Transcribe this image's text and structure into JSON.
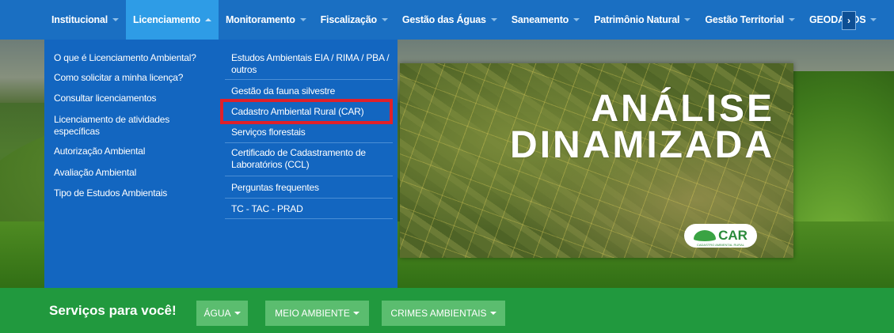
{
  "nav": {
    "items": [
      {
        "label": "Institucional"
      },
      {
        "label": "Licenciamento"
      },
      {
        "label": "Monitoramento"
      },
      {
        "label": "Fiscalização"
      },
      {
        "label": "Gestão das Águas"
      },
      {
        "label": "Saneamento"
      },
      {
        "label": "Patrimônio Natural"
      },
      {
        "label": "Gestão Territorial"
      },
      {
        "label": "GEODADOS"
      }
    ],
    "active_index": 1,
    "more_label": "›"
  },
  "dropdown": {
    "left": [
      "O que é Licenciamento Ambiental?",
      "Como solicitar a minha licença?",
      "Consultar licenciamentos",
      "Licenciamento de atividades específicas",
      "Autorização Ambiental",
      "Avaliação Ambiental",
      "Tipo de Estudos Ambientais"
    ],
    "right": [
      "Estudos Ambientais EIA / RIMA / PBA / outros",
      "Gestão da fauna silvestre",
      "Cadastro Ambiental Rural (CAR)",
      "Serviços florestais",
      "Certificado de Cadastramento de Laboratórios (CCL)",
      "Perguntas frequentes",
      "TC - TAC - PRAD"
    ],
    "highlighted": "Cadastro Ambiental Rural (CAR)"
  },
  "hero": {
    "title_line1": "ANÁLISE",
    "title_line2": "DINAMIZADA",
    "badge": "CAR",
    "badge_sub": "CADASTRO AMBIENTAL RURAL"
  },
  "services": {
    "title": "Serviços para você!",
    "buttons": [
      "ÁGUA",
      "MEIO AMBIENTE",
      "CRIMES AMBIENTAIS"
    ]
  },
  "colors": {
    "nav_bg": "#1a6fc2",
    "nav_active": "#2e9ce6",
    "dropdown_bg": "#1366c0",
    "highlight": "#e0202a",
    "services_bg": "#21993e",
    "services_btn": "#5bbd6f"
  }
}
